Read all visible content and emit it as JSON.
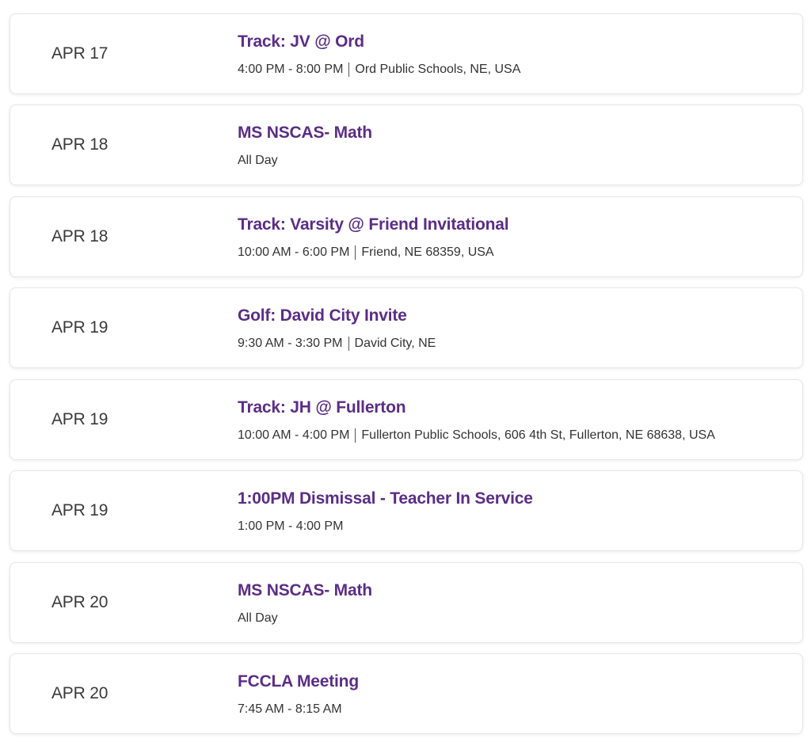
{
  "events": [
    {
      "date": "APR 17",
      "title": "Track: JV @ Ord",
      "time": "4:00 PM - 8:00 PM",
      "location": "Ord Public Schools, NE, USA"
    },
    {
      "date": "APR 18",
      "title": "MS NSCAS- Math",
      "time": "All Day",
      "location": ""
    },
    {
      "date": "APR 18",
      "title": "Track: Varsity @ Friend Invitational",
      "time": "10:00 AM - 6:00 PM",
      "location": "Friend, NE 68359, USA"
    },
    {
      "date": "APR 19",
      "title": "Golf: David City Invite",
      "time": "9:30 AM - 3:30 PM",
      "location": "David City, NE"
    },
    {
      "date": "APR 19",
      "title": "Track: JH @ Fullerton",
      "time": "10:00 AM - 4:00 PM",
      "location": "Fullerton Public Schools, 606 4th St, Fullerton, NE 68638, USA"
    },
    {
      "date": "APR 19",
      "title": "1:00PM Dismissal - Teacher In Service",
      "time": "1:00 PM - 4:00 PM",
      "location": ""
    },
    {
      "date": "APR 20",
      "title": "MS NSCAS- Math",
      "time": "All Day",
      "location": ""
    },
    {
      "date": "APR 20",
      "title": "FCCLA Meeting",
      "time": "7:45 AM - 8:15 AM",
      "location": ""
    }
  ],
  "colors": {
    "title": "#5b2d86",
    "text": "#333333",
    "date": "#3a3a3a",
    "border": "#e6e6e6"
  }
}
